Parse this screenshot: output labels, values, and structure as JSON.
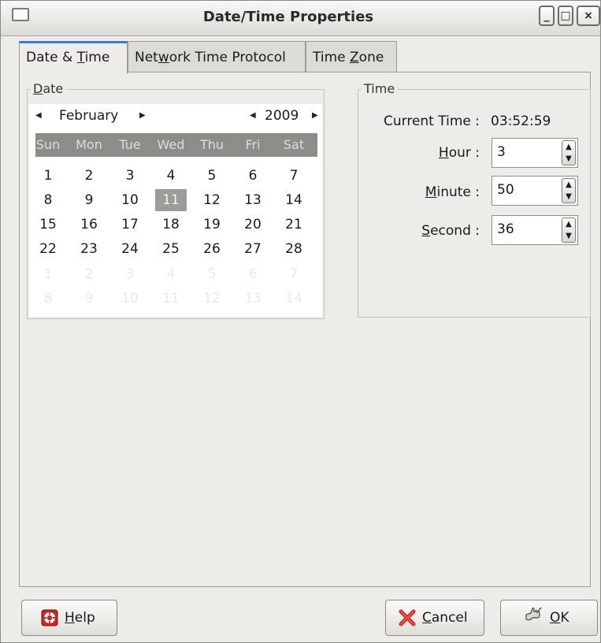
{
  "window": {
    "title": "Date/Time Properties",
    "minimize_glyph": "_",
    "maximize_glyph": "□",
    "close_glyph": "×"
  },
  "tabs": [
    {
      "pre": "Date & ",
      "key": "T",
      "post": "ime",
      "active": true
    },
    {
      "pre": "Net",
      "key": "w",
      "post": "ork Time Protocol",
      "active": false
    },
    {
      "pre": "Time ",
      "key": "Z",
      "post": "one",
      "active": false
    }
  ],
  "date_frame": {
    "key": "D",
    "post": "ate"
  },
  "calendar": {
    "month": "February",
    "year": "2009",
    "weekdays": [
      "Sun",
      "Mon",
      "Tue",
      "Wed",
      "Thu",
      "Fri",
      "Sat"
    ],
    "weeks": [
      [
        "1",
        "2",
        "3",
        "4",
        "5",
        "6",
        "7"
      ],
      [
        "8",
        "9",
        "10",
        "11",
        "12",
        "13",
        "14"
      ],
      [
        "15",
        "16",
        "17",
        "18",
        "19",
        "20",
        "21"
      ],
      [
        "22",
        "23",
        "24",
        "25",
        "26",
        "27",
        "28"
      ],
      [
        "1",
        "2",
        "3",
        "4",
        "5",
        "6",
        "7"
      ],
      [
        "8",
        "9",
        "10",
        "11",
        "12",
        "13",
        "14"
      ]
    ],
    "selected_day": "11"
  },
  "time_frame": {
    "title": "Time",
    "current_time_label": "Current Time :",
    "current_time_value": "03:52:59",
    "hour": {
      "key": "H",
      "post": "our :",
      "value": "3"
    },
    "minute": {
      "key": "M",
      "post": "inute :",
      "value": "50"
    },
    "second": {
      "key": "S",
      "post": "econd :",
      "value": "36"
    }
  },
  "buttons": {
    "help": {
      "key": "H",
      "post": "elp"
    },
    "cancel": {
      "key": "C",
      "post": "ancel"
    },
    "ok": {
      "key": "O",
      "post": "K"
    }
  },
  "icons": {
    "help": "lifebuoy-icon",
    "cancel": "red-x-icon",
    "ok": "checkmark-hand-icon"
  },
  "colors": {
    "accent_tab": "#4b7ab8",
    "selected_day_bg": "#9c9b97",
    "weekday_bar": "#8d8c88",
    "help_icon": "#c62828",
    "cancel_icon": "#c62828"
  }
}
